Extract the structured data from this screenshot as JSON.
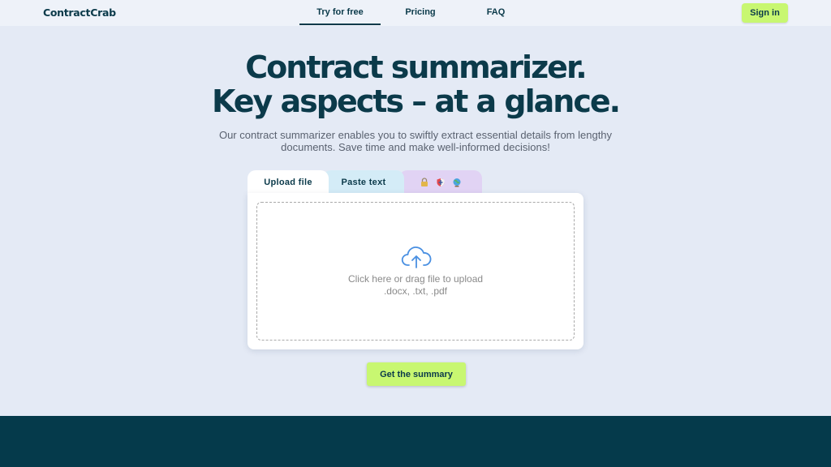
{
  "header": {
    "logo": "ContractCrab",
    "nav": [
      "Try for free",
      "Pricing",
      "FAQ"
    ],
    "sign_in": "Sign in"
  },
  "hero": {
    "title_line1": "Contract summarizer.",
    "title_line2": "Key aspects – at a glance.",
    "subtitle_line1": "Our contract summarizer enables you to swiftly extract essential details from lengthy",
    "subtitle_line2": "documents. Save time and make well-informed decisions!"
  },
  "tabs": {
    "upload": "Upload file",
    "paste": "Paste text",
    "icons": [
      "lock-icon",
      "shield-icon",
      "globe-icon"
    ]
  },
  "dropzone": {
    "line1": "Click here or drag file to upload",
    "line2": ".docx, .txt, .pdf"
  },
  "cta": "Get the summary",
  "colors": {
    "brand_dark": "#0b3a4a",
    "accent_lime": "#c8f771",
    "background": "#e4eaf5",
    "footer": "#053a4b",
    "tab_paste": "#d4ecf7",
    "tab_icons": "#e1d3f4",
    "upload_icon": "#4a90e2"
  }
}
